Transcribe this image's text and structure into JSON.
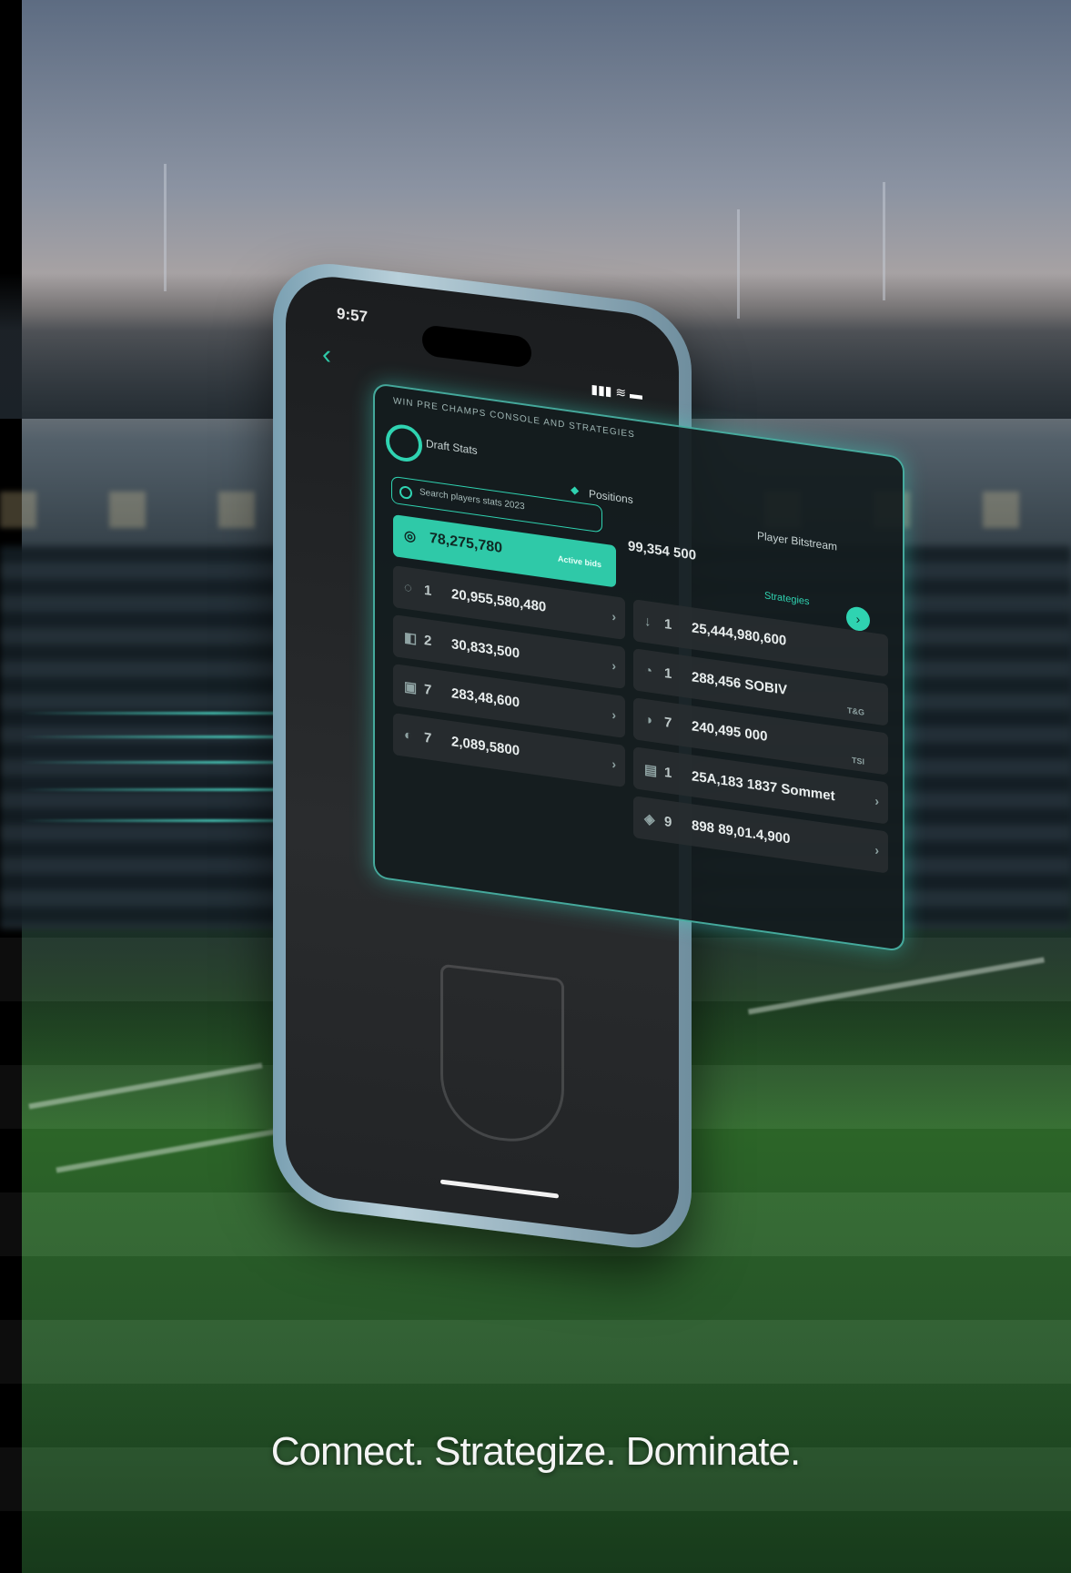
{
  "phone": {
    "time": "9:57",
    "status_icons": "▮▮▮ ≋ ▬",
    "back_icon": "chevron-left-icon"
  },
  "panel": {
    "header": "WIN PRE CHAMPS CONSOLE AND STRATEGIES",
    "tabs": [
      "Draft Stats",
      "Positions",
      "Player Bitstream"
    ],
    "search_placeholder": "Search players  stats  2023",
    "top_amount": "99,354 500",
    "highlight_value": "78,275,780",
    "highlight_sub": "Active bids",
    "badge": "Strategies",
    "left_rows": [
      {
        "idx": "1",
        "value": "20,955,580,480"
      },
      {
        "idx": "2",
        "value": "30,833,500"
      },
      {
        "idx": "7",
        "value": "283,48,600"
      },
      {
        "idx": "7",
        "value": "2,089,5800"
      }
    ],
    "right_rows": [
      {
        "idx": "1",
        "value": "25,444,980,600",
        "side": ""
      },
      {
        "idx": "1",
        "value": "288,456 SOBIV",
        "side": "T&G"
      },
      {
        "idx": "7",
        "value": "240,495 000",
        "side": "TSI"
      },
      {
        "idx": "1",
        "value": "25A,183 1837 Sommet",
        "side": ""
      },
      {
        "idx": "9",
        "value": "898 89,01.4,900",
        "side": ""
      }
    ]
  },
  "tagline": "Connect. Strategize. Dominate."
}
